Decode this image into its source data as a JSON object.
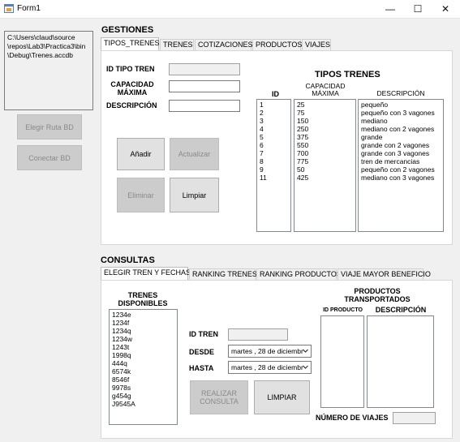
{
  "window": {
    "title": "Form1",
    "minimize_glyph": "—",
    "maximize_glyph": "☐",
    "close_glyph": "✕"
  },
  "db_path": "C:\\Users\\claud\\source\\repos\\Lab3\\Practica3\\bin\\Debug\\Trenes.accdb",
  "db_path_lines": [
    "C:\\Users\\claud\\source",
    "\\repos\\Lab3\\Practica3\\bin",
    "\\Debug\\Trenes.accdb"
  ],
  "left_buttons": {
    "choose_db": "Elegir Ruta BD",
    "connect_db": "Conectar BD"
  },
  "gestiones": {
    "title": "GESTIONES",
    "tabs": [
      "TIPOS_TRENES",
      "TRENES",
      "COTIZACIONES",
      "PRODUCTOS",
      "VIAJES"
    ],
    "active_tab": "TIPOS_TRENES",
    "labels": {
      "id_tipo": "ID TIPO TREN",
      "capacidad_1": "CAPACIDAD",
      "capacidad_2": "MÁXIMA",
      "descripcion": "DESCRIPCIÓN"
    },
    "inputs": {
      "id_tipo": "",
      "capacidad": "",
      "descripcion": ""
    },
    "buttons": {
      "add": "Añadir",
      "update": "Actualizar",
      "delete": "Eliminar",
      "clear": "Limpiar"
    },
    "table_title": "TIPOS TRENES",
    "col_id": "ID",
    "col_cap_1": "CAPACIDAD",
    "col_cap_2": "MÁXIMA",
    "col_desc": "DESCRIPCIÓN",
    "ids": [
      "1",
      "2",
      "3",
      "4",
      "5",
      "6",
      "7",
      "8",
      "9",
      "11"
    ],
    "capacities": [
      "25",
      "75",
      "150",
      "250",
      "375",
      "550",
      "700",
      "775",
      "50",
      "425"
    ],
    "descriptions": [
      "pequeño",
      "pequeño con 3 vagones",
      "mediano",
      "mediano con 2 vagones",
      "grande",
      "grande con 2 vagones",
      "grande con 3 vagones",
      "tren de mercancias",
      "pequeño con 2 vagones",
      "mediano con 3 vagones"
    ]
  },
  "consultas": {
    "title": "CONSULTAS",
    "tabs": [
      "ELEGIR TREN Y FECHAS",
      "RANKING TRENES",
      "RANKING PRODUCTOS",
      "VIAJE MAYOR BENEFICIO"
    ],
    "active_tab": "ELEGIR TREN Y FECHAS",
    "trains_title_1": "TRENES",
    "trains_title_2": "DISPONIBLES",
    "trains": [
      "1234e",
      "1234f",
      "1234q",
      "1234w",
      "1243t",
      "1998q",
      "444q",
      "6574k",
      "8546f",
      "9978s",
      "g454g",
      "J9545A"
    ],
    "labels": {
      "id_tren": "ID TREN",
      "desde": "DESDE",
      "hasta": "HASTA",
      "num_viajes": "NÚMERO DE VIAJES"
    },
    "inputs": {
      "id_tren": "",
      "num_viajes": ""
    },
    "desde_value": "martes  , 28 de  diciembr",
    "hasta_value": "martes  , 28 de  diciembr",
    "buttons": {
      "query_1": "REALIZAR",
      "query_2": "CONSULTA",
      "clear": "LIMPIAR"
    },
    "products_title_1": "PRODUCTOS",
    "products_title_2": "TRANSPORTADOS",
    "col_id_producto": "ID PRODUCTO",
    "col_descripcion": "DESCRIPCIÓN"
  }
}
